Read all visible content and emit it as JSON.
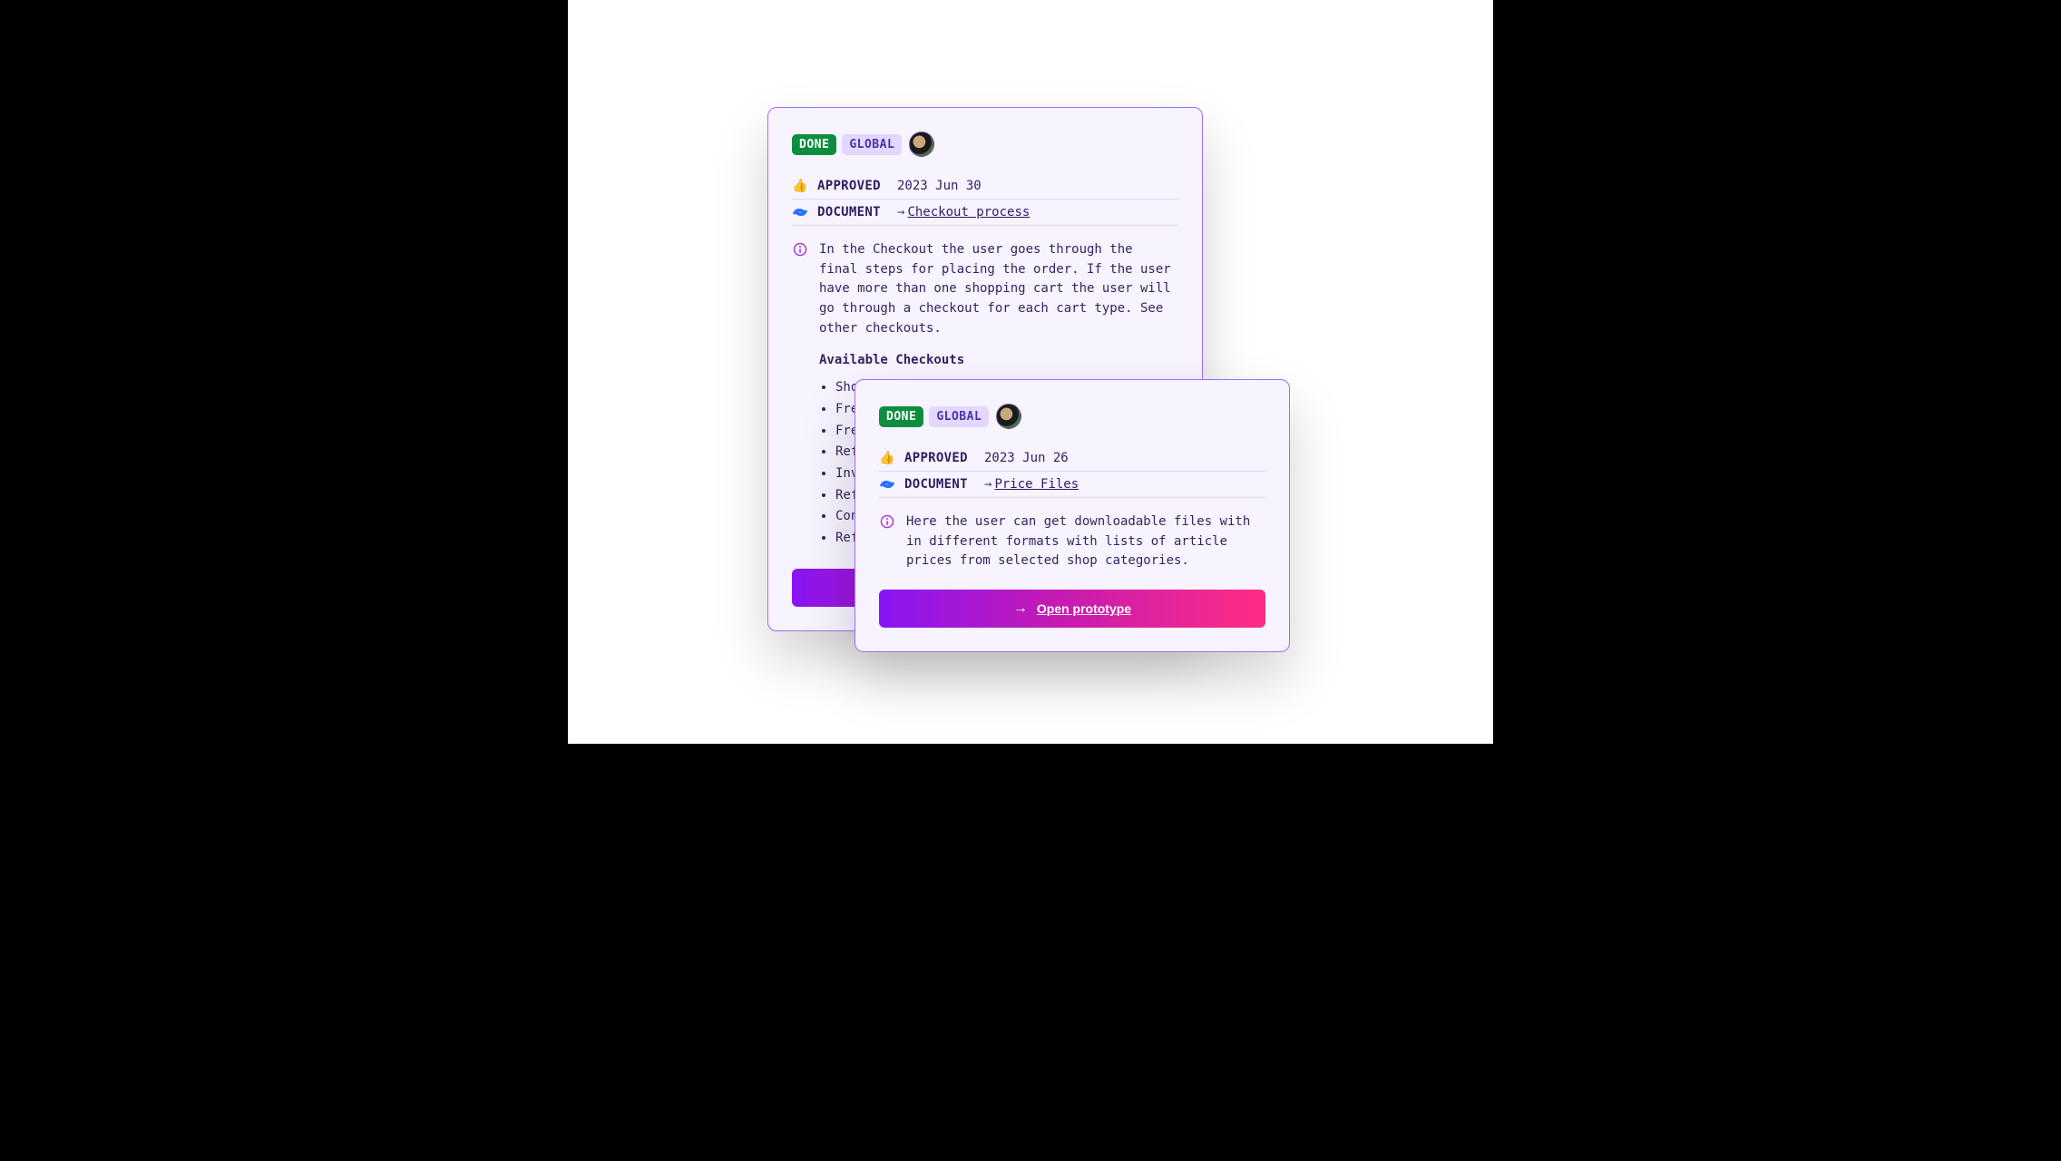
{
  "badges": {
    "done": "DONE",
    "global": "GLOBAL"
  },
  "labels": {
    "approved": "APPROVED",
    "document": "DOCUMENT",
    "link_arrow": "→"
  },
  "button": {
    "open_prototype": "Open prototype"
  },
  "card_a": {
    "approved_date": "2023 Jun 30",
    "document_link": "Checkout process",
    "description": "In the Checkout the user goes through the final steps for placing the order. If the user have more than one shopping cart the user will go through a checkout for each cart type. See other checkouts.",
    "subheading": "Available Checkouts",
    "list": [
      "Shopping (regular catalog articles)",
      "Free sample",
      "Free",
      "Refi",
      "Invo",
      "Refi",
      "Cons",
      "Refi"
    ]
  },
  "card_b": {
    "approved_date": "2023 Jun 26",
    "document_link": "Price Files",
    "description": "Here the user can get downloadable files with in different formats with lists of article prices from selected shop categories."
  }
}
